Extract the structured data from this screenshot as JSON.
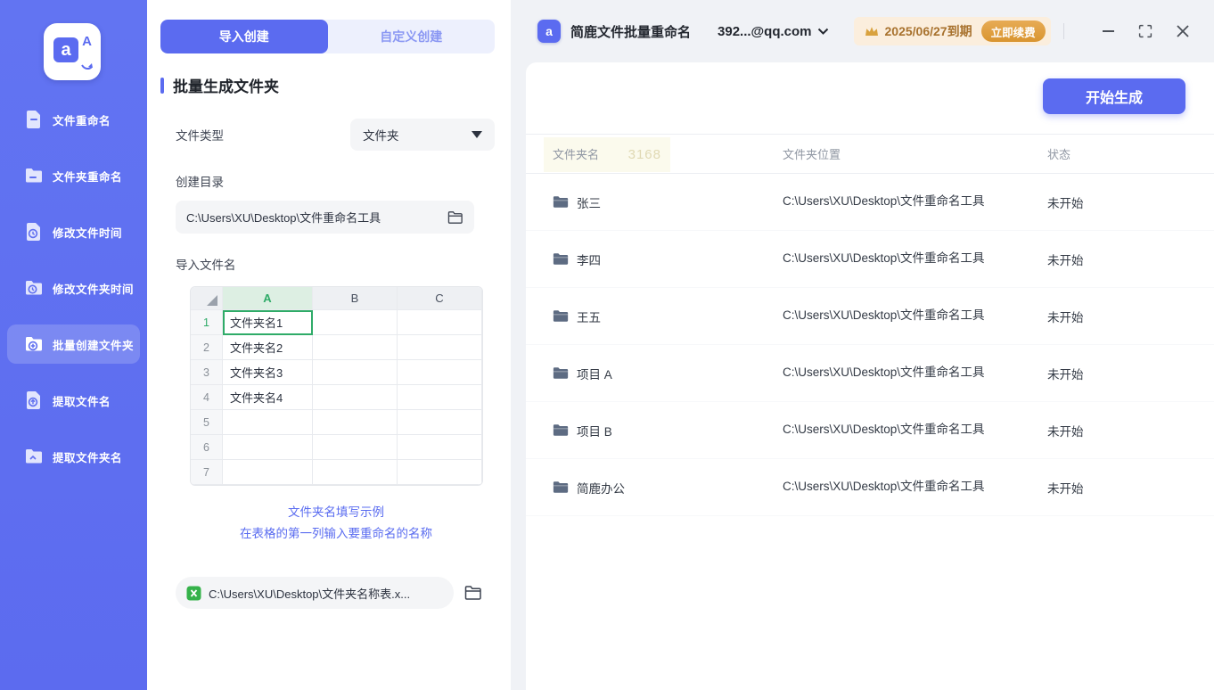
{
  "logo": {
    "letter_small": "a",
    "letter_big": "A"
  },
  "sidebar": {
    "items": [
      {
        "label": "文件重命名"
      },
      {
        "label": "文件夹重命名"
      },
      {
        "label": "修改文件时间"
      },
      {
        "label": "修改文件夹时间"
      },
      {
        "label": "批量创建文件夹",
        "active": true
      },
      {
        "label": "提取文件名"
      },
      {
        "label": "提取文件夹名"
      }
    ]
  },
  "panel": {
    "tabs": {
      "import": "导入创建",
      "custom": "自定义创建"
    },
    "section_title": "批量生成文件夹",
    "file_type_label": "文件类型",
    "file_type_value": "文件夹",
    "create_dir_label": "创建目录",
    "create_dir_value": "C:\\Users\\XU\\Desktop\\文件重命名工具",
    "import_label": "导入文件名",
    "sheet": {
      "columns": [
        "A",
        "B",
        "C"
      ],
      "rows": [
        {
          "n": "1",
          "a": "文件夹名1"
        },
        {
          "n": "2",
          "a": "文件夹名2"
        },
        {
          "n": "3",
          "a": "文件夹名3"
        },
        {
          "n": "4",
          "a": "文件夹名4"
        },
        {
          "n": "5",
          "a": ""
        },
        {
          "n": "6",
          "a": ""
        },
        {
          "n": "7",
          "a": ""
        }
      ]
    },
    "hint_line1": "文件夹名填写示例",
    "hint_line2": "在表格的第一列输入要重命名的名称",
    "file_path_value": "C:\\Users\\XU\\Desktop\\文件夹名称表.x..."
  },
  "titlebar": {
    "app_title": "简鹿文件批量重命名",
    "app_icon_letter": "a",
    "account": "392...@qq.com",
    "expiry": "2025/06/27到期",
    "renew_label": "立即续费"
  },
  "main": {
    "generate_label": "开始生成",
    "watermark": "3168",
    "table": {
      "headers": [
        "文件夹名",
        "文件夹位置",
        "状态"
      ],
      "rows": [
        {
          "name": "张三",
          "path": "C:\\Users\\XU\\Desktop\\文件重命名工具",
          "status": "未开始"
        },
        {
          "name": "李四",
          "path": "C:\\Users\\XU\\Desktop\\文件重命名工具",
          "status": "未开始"
        },
        {
          "name": "王五",
          "path": "C:\\Users\\XU\\Desktop\\文件重命名工具",
          "status": "未开始"
        },
        {
          "name": "项目 A",
          "path": "C:\\Users\\XU\\Desktop\\文件重命名工具",
          "status": "未开始"
        },
        {
          "name": "项目 B",
          "path": "C:\\Users\\XU\\Desktop\\文件重命名工具",
          "status": "未开始"
        },
        {
          "name": "简鹿办公",
          "path": "C:\\Users\\XU\\Desktop\\文件重命名工具",
          "status": "未开始"
        }
      ]
    }
  },
  "colors": {
    "accent": "#5b6bf0",
    "sidebar": "#5f6ff0",
    "green": "#2fab68",
    "vip_bg": "#fbeedd",
    "vip_text": "#a8722e",
    "renew_bg": "#d99530"
  }
}
